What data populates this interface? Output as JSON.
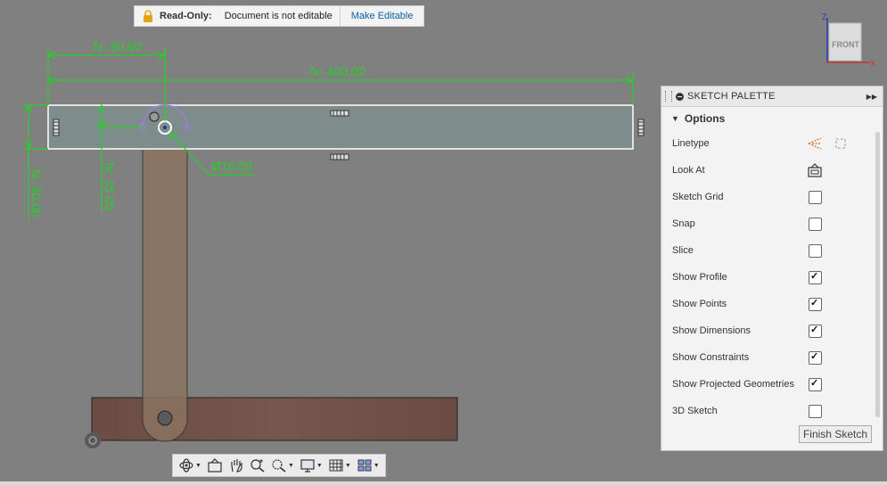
{
  "banner": {
    "title": "Read-Only:",
    "message": "Document is not editable",
    "action": "Make Editable"
  },
  "viewcube": {
    "face": "FRONT",
    "axis_z": "Z",
    "axis_x": "X"
  },
  "sketch": {
    "dim_80": "fx: 80.00",
    "dim_400": "fx: 400.00",
    "dim_30": "fx: 30.00",
    "dim_15": "fx: 15.00",
    "dim_dia": "Ø10.00"
  },
  "palette": {
    "title": "SKETCH PALETTE",
    "section": "Options",
    "rows": [
      {
        "label": "Linetype",
        "control": "linetype-icons"
      },
      {
        "label": "Look At",
        "control": "look-at-icon"
      },
      {
        "label": "Sketch Grid",
        "checked": false
      },
      {
        "label": "Snap",
        "checked": false
      },
      {
        "label": "Slice",
        "checked": false
      },
      {
        "label": "Show Profile",
        "checked": true
      },
      {
        "label": "Show Points",
        "checked": true
      },
      {
        "label": "Show Dimensions",
        "checked": true
      },
      {
        "label": "Show Constraints",
        "checked": true
      },
      {
        "label": "Show Projected Geometries",
        "checked": true
      },
      {
        "label": "3D Sketch",
        "checked": false
      }
    ],
    "finish": "Finish Sketch"
  },
  "colors": {
    "dimension": "#22d422",
    "sketch_selected": "#ffffff",
    "constraint_arc": "#9b7fd4",
    "bar_fill": "#7e8c8c",
    "link_fill": "#8a735f",
    "base_fill": "#6e5048",
    "link_text": "#0a5fa8"
  },
  "toolbar": [
    "orbit-icon",
    "look-at-icon",
    "pan-icon",
    "zoom-icon",
    "fit-icon",
    "display-icon",
    "grid-icon",
    "viewports-icon"
  ]
}
